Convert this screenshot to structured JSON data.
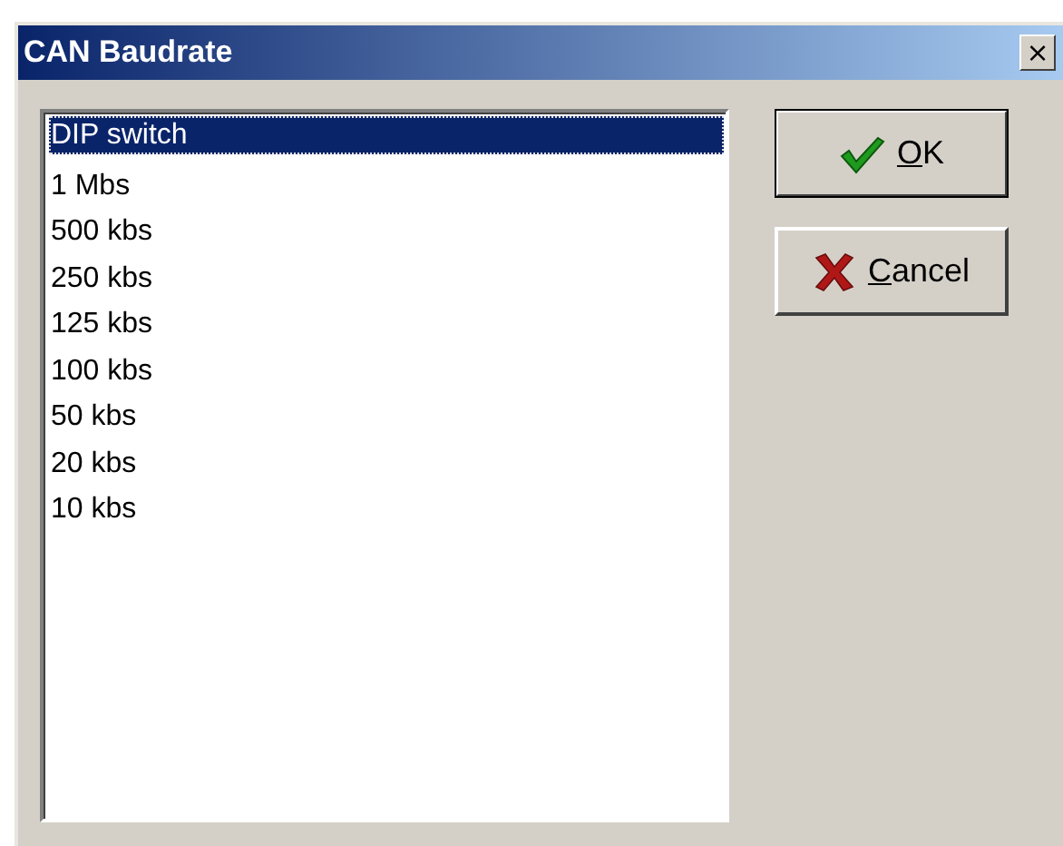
{
  "window": {
    "title": "CAN Baudrate",
    "close": "×"
  },
  "list": {
    "items": [
      {
        "label": "DIP switch",
        "selected": true
      },
      {
        "label": "1 Mbs",
        "selected": false
      },
      {
        "label": "500 kbs",
        "selected": false
      },
      {
        "label": "250 kbs",
        "selected": false
      },
      {
        "label": "125 kbs",
        "selected": false
      },
      {
        "label": "100 kbs",
        "selected": false
      },
      {
        "label": "50 kbs",
        "selected": false
      },
      {
        "label": "20 kbs",
        "selected": false
      },
      {
        "label": "10 kbs",
        "selected": false
      }
    ]
  },
  "buttons": [
    {
      "kind": "ok",
      "accel": "O",
      "rest": "K",
      "default": true
    },
    {
      "kind": "cancel",
      "accel": "C",
      "rest": "ancel",
      "default": false
    }
  ]
}
